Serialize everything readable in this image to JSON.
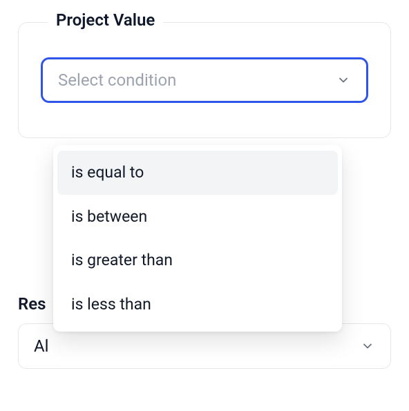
{
  "project_value": {
    "legend": "Project Value",
    "condition_select": {
      "placeholder": "Select condition",
      "options": [
        {
          "label": "is equal to",
          "highlighted": true
        },
        {
          "label": "is between",
          "highlighted": false
        },
        {
          "label": "is greater than",
          "highlighted": false
        },
        {
          "label": "is less than",
          "highlighted": false
        }
      ]
    }
  },
  "lower_section": {
    "label_visible": "Res",
    "select_value_visible": "Al"
  }
}
